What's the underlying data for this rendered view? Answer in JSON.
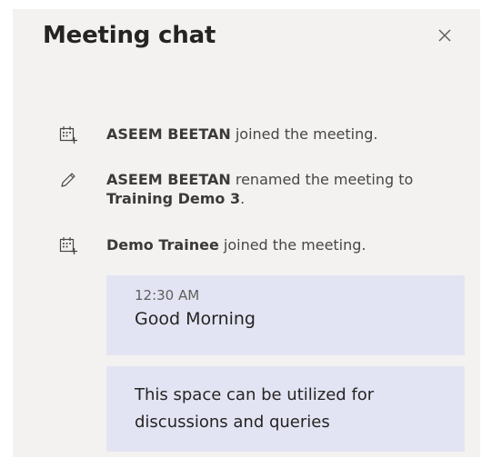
{
  "header": {
    "title": "Meeting chat",
    "close_icon": "close-icon"
  },
  "events": [
    {
      "icon": "calendar-add-icon",
      "who": "ASEEM BEETAN",
      "rest": " joined the meeting."
    },
    {
      "icon": "pencil-icon",
      "who": "ASEEM BEETAN",
      "rest": " renamed the meeting to ",
      "target": "Training Demo 3",
      "suffix": "."
    },
    {
      "icon": "calendar-add-icon",
      "who": "Demo Trainee",
      "rest": " joined the meeting."
    }
  ],
  "messages": [
    {
      "time": "12:30 AM",
      "text": "Good Morning"
    },
    {
      "text": "This space can be utilized for discussions and queries"
    }
  ],
  "colors": {
    "panel_bg": "#f3f2f1",
    "message_bg": "#e3e4f3",
    "text": "#252423"
  }
}
